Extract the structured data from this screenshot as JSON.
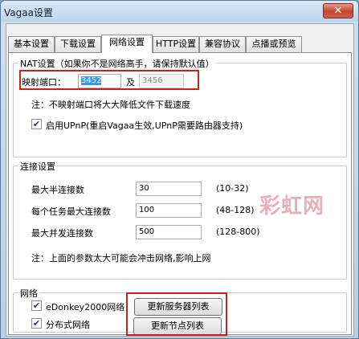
{
  "window": {
    "title": "Vagaa设置",
    "close_glyph": "✕"
  },
  "tabs": [
    {
      "label": "基本设置"
    },
    {
      "label": "下载设置"
    },
    {
      "label": "网络设置",
      "active": true
    },
    {
      "label": "HTTP设置"
    },
    {
      "label": "兼容协议"
    },
    {
      "label": "点播或预览"
    }
  ],
  "nat": {
    "title": "NAT设置（如果你不是网络高手，请保持默认值）",
    "port_label": "映射端口：",
    "port_value": "3452",
    "and_label": "及",
    "port2_value": "3456",
    "note": "注：不映射端口将大大降低文件下载速度",
    "upnp_label": "启用UPnP(重启Vagaa生效,UPnP需要路由器支持)",
    "upnp_checked": true
  },
  "connections": {
    "title": "连接设置",
    "rows": [
      {
        "label": "最大半连接数",
        "value": "30",
        "range": "(10-32)"
      },
      {
        "label": "每个任务最大连接数",
        "value": "100",
        "range": "(48-128)"
      },
      {
        "label": "最大并发连接数",
        "value": "500",
        "range": "(128-800)"
      }
    ],
    "note": "注：上面的参数太大可能会冲击网络,影响上网"
  },
  "network": {
    "title": "网络",
    "edonkey_label": "eDonkey2000网络",
    "edonkey_checked": true,
    "distributed_label": "分布式网络",
    "distributed_checked": true,
    "update_servers_button": "更新服务器列表",
    "update_nodes_button": "更新节点列表"
  },
  "check_glyph": "✔",
  "watermark": "彩虹网",
  "colors": {
    "highlight": "#cc1f1f",
    "selection": "#3399ff"
  }
}
